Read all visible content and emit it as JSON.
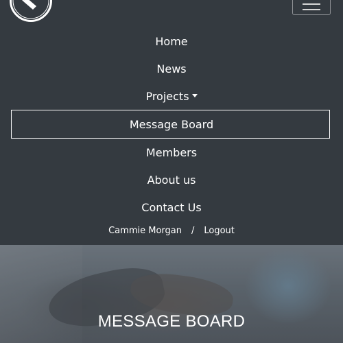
{
  "nav": {
    "items": [
      {
        "label": "Home"
      },
      {
        "label": "News"
      },
      {
        "label": "Projects"
      },
      {
        "label": "Message Board"
      },
      {
        "label": "Members"
      },
      {
        "label": "About us"
      },
      {
        "label": "Contact Us"
      }
    ],
    "active": "Message Board"
  },
  "user": {
    "name": "Cammie Morgan",
    "separator": "/",
    "logout": "Logout"
  },
  "hero": {
    "title": "MESSAGE BOARD"
  },
  "colors": {
    "navbar_bg": "#343a40",
    "text": "#ffffff"
  }
}
